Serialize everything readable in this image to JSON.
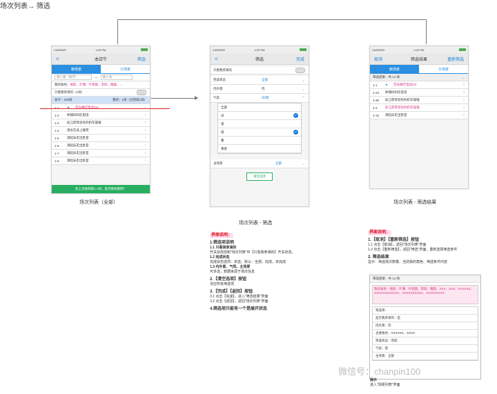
{
  "header": {
    "title": "场次列表→ 筛选"
  },
  "screen1": {
    "status": {
      "carrier": "CARRIER",
      "time": "4:20 PM"
    },
    "nav": {
      "back": "<",
      "title": "本店牛",
      "right": "筛选"
    },
    "tabs": [
      "赖场景",
      "分场景"
    ],
    "input_left": "输入集（数字）",
    "input_right": "输入场",
    "roles_label": "我的角色：",
    "roles_text": "刷脸、叶薄、叶夜薇、李四、赌圆、...",
    "only_mine": "只看我参演的（1场）",
    "summary_left": "总计：100场",
    "summary_right": "我的：1场（已完成1场）",
    "rows": [
      {
        "num": "1-1",
        "text": "荧光棒打电话OS",
        "pink": true
      },
      {
        "num": "1-2",
        "text": "摔铺码码吃电话"
      },
      {
        "num": "1-3",
        "text": "赵江蔚等巡检的奶车操铺"
      },
      {
        "num": "1-4",
        "text": "演女在床上睡晃"
      },
      {
        "num": "1-5",
        "text": "演起床走出卧室"
      },
      {
        "num": "1-6",
        "text": "演起床走出卧室"
      },
      {
        "num": "1-7",
        "text": "演起床走出卧室"
      },
      {
        "num": "1-8",
        "text": "演起床走出卧室"
      }
    ],
    "banner": "您上次拍到第1-1场，是否继续跳转？",
    "caption": "场次列表（全部）"
  },
  "screen2": {
    "status": {
      "carrier": "CARRIER",
      "time": "4:20 PM"
    },
    "nav": {
      "back": "<",
      "title": "筛选",
      "right": "完成"
    },
    "only_mine": "只看我参演的",
    "complete_label": "完成状态",
    "complete_value": "全部",
    "scene_label": "内外景",
    "scene_value": "内",
    "weather_label": "气氛",
    "weather_value": "日/雨",
    "options": [
      "全部",
      "日",
      "夜",
      "雨",
      "雾",
      "黄昏"
    ],
    "main_label": "主场景",
    "main_value": "全部",
    "clear_button": "清空选项",
    "caption": "场次列表 - 筛选"
  },
  "screen3": {
    "status": {
      "carrier": "CARRIER",
      "time": "4:20 PM"
    },
    "nav": {
      "left": "取消",
      "title": "筛选结果",
      "right": "重新筛选"
    },
    "tabs": [
      "赖场景",
      "分场景"
    ],
    "result_label": "筛选结果：共 14 场",
    "rows": [
      {
        "num": "1-1",
        "text": "荧光棒打电话OS",
        "pink": true
      },
      {
        "num": "1-23",
        "text": "摔铺码码吃电话"
      },
      {
        "num": "1-36",
        "text": "赵江蔚等巡检的奶车操铺"
      },
      {
        "num": "2-3",
        "text": "赵江蔚等巡检的奶车操铺",
        "pink": true
      },
      {
        "num": "2-15",
        "text": "演起床走出卧室"
      }
    ],
    "caption": "场次列表 - 筛选结果"
  },
  "doc2": {
    "heading": "界面说明：",
    "h1": "1.筛选项说明",
    "l1": "1.1 只看我参演的",
    "l2": "开关状态控制\"场次列表\"中【只看我参演的】开关状态。",
    "l3": "1.2 完成状态",
    "l4": "完成状态选项：单选，默认：全部，完成，未完成",
    "l5": "1.3 内外景、气氛、主场景",
    "l6": "可多选，数据来源于场次信息",
    "h2": "2.【清空选项】按钮",
    "l7": "清空所有筛选项",
    "h3": "3.【完成】【返回】按钮",
    "l8": "3.1 点击【完成】，进入\"筛选结果\"界面",
    "l9": "3.2 点击【返回】，返回\"场次列表\"界面",
    "h4": "4.筛选项只能有一个是展开状态"
  },
  "doc3": {
    "heading": "界面说明：",
    "h1": "1.【取消】【重新筛选】按钮",
    "l1": "1.1 点击【取消】，返回\"场次列表\"界面",
    "l2": "1.2 点击【重新筛选】，返回\"筛选\"界面，重新选择筛选条件",
    "h2": "2. 筛选结果",
    "l3": "显示：筛选场次数量、当前我的角色、筛选条件内容",
    "panel_title": "筛选结果：共 14 场",
    "panel_roles": "我的角色：刷脸、叶薄、叶夜薇、李四、赌圆、XXX、XXX、XXXXXX、XXXXXXXXXXXX、XXXXXXXXXX、XXXXXXXXX",
    "panel_items": [
      "筛选项：",
      "是否我参演的：是",
      "内外景：内",
      "主要角色：XXXXXX、XXXX",
      "完成状态：完成",
      "气氛：夜",
      "主场景：全部"
    ],
    "footer1": "展示",
    "footer2": "进入\"场景列表\"界面"
  },
  "watermark": "微信号：chanpin100"
}
